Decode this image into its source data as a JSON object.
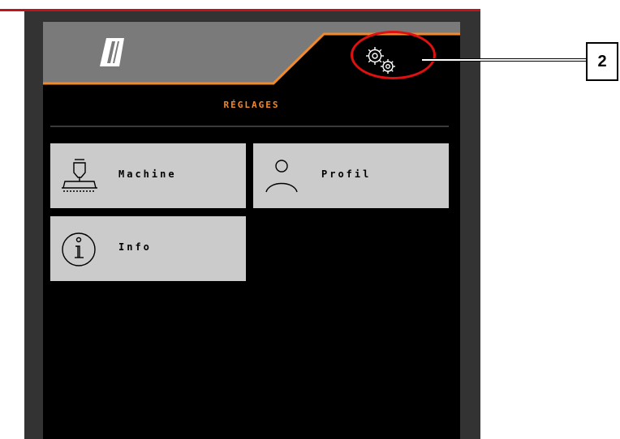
{
  "screen": {
    "title": "RÉGLAGES",
    "accent_color": "#f08a2c"
  },
  "header": {
    "logo_icon": "machine-logo-icon",
    "settings_icon": "gears-icon"
  },
  "menu": {
    "items": [
      {
        "label": "Machine",
        "icon": "seed-drill-icon"
      },
      {
        "label": "Profil",
        "icon": "user-profile-icon"
      },
      {
        "label": "Info",
        "icon": "info-icon"
      }
    ]
  },
  "callout": {
    "number": "2",
    "color": "#e01010"
  }
}
